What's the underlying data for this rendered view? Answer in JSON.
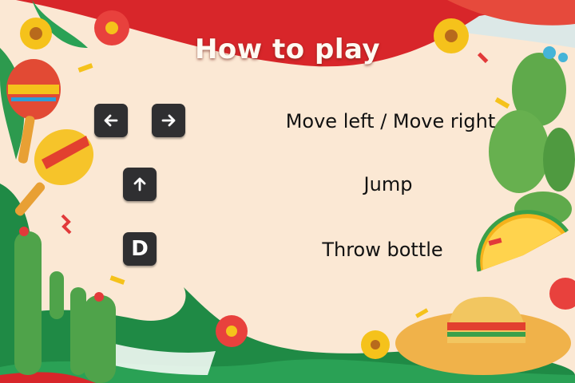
{
  "screen": {
    "title": "How to play",
    "controls": [
      {
        "keys": [
          "left-arrow",
          "right-arrow"
        ],
        "label": "Move left / Move right"
      },
      {
        "keys": [
          "up-arrow"
        ],
        "label": "Jump"
      },
      {
        "keys": [
          "D"
        ],
        "label": "Throw bottle"
      }
    ]
  },
  "colors": {
    "background": "#fbe8d4",
    "key_bg": "#2f2f31",
    "banner_red": "#d8262a",
    "banner_green": "#1f8a45",
    "title_text": "#fffaf2"
  }
}
